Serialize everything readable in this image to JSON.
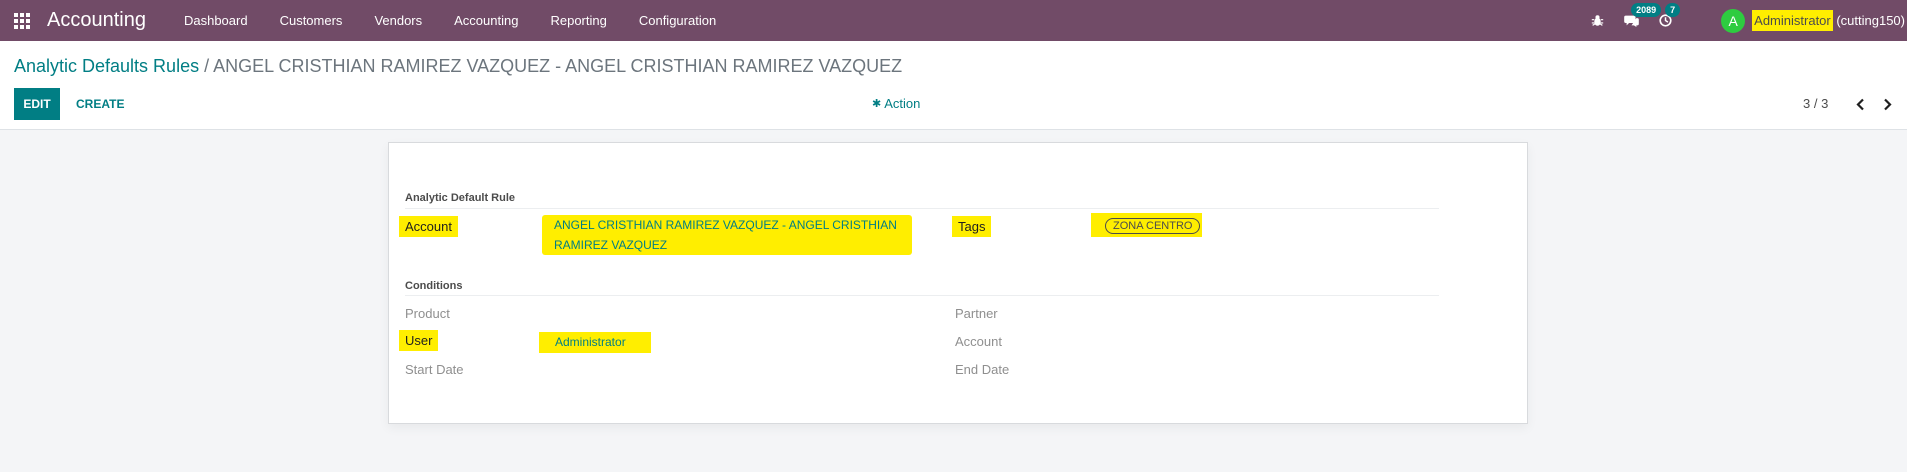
{
  "navbar": {
    "app_name": "Accounting",
    "menu": [
      "Dashboard",
      "Customers",
      "Vendors",
      "Accounting",
      "Reporting",
      "Configuration"
    ],
    "messages_count": "2089",
    "activities_count": "7",
    "avatar_letter": "A",
    "user_name": "Administrator",
    "user_db": " (cutting150)"
  },
  "breadcrumb": {
    "parent": "Analytic Defaults Rules",
    "separator": " / ",
    "current": "ANGEL CRISTHIAN RAMIREZ VAZQUEZ - ANGEL CRISTHIAN RAMIREZ VAZQUEZ"
  },
  "buttons": {
    "edit": "EDIT",
    "create": "CREATE",
    "action": "Action"
  },
  "pager": {
    "text": "3 / 3"
  },
  "form": {
    "group1_title": "Analytic Default Rule",
    "account_label": "Account",
    "account_value_line1": "ANGEL CRISTHIAN RAMIREZ VAZQUEZ - ANGEL CRISTHIAN",
    "account_value_line2": "RAMIREZ VAZQUEZ",
    "tags_label": "Tags",
    "tag_value": "ZONA CENTRO",
    "group2_title": "Conditions",
    "product_label": "Product",
    "partner_label": "Partner",
    "user_label": "User",
    "user_value": "Administrator",
    "account2_label": "Account",
    "start_date_label": "Start Date",
    "end_date_label": "End Date"
  },
  "colors": {
    "navbar": "#714b67",
    "primary": "#017e84",
    "highlight": "#ffee00"
  }
}
